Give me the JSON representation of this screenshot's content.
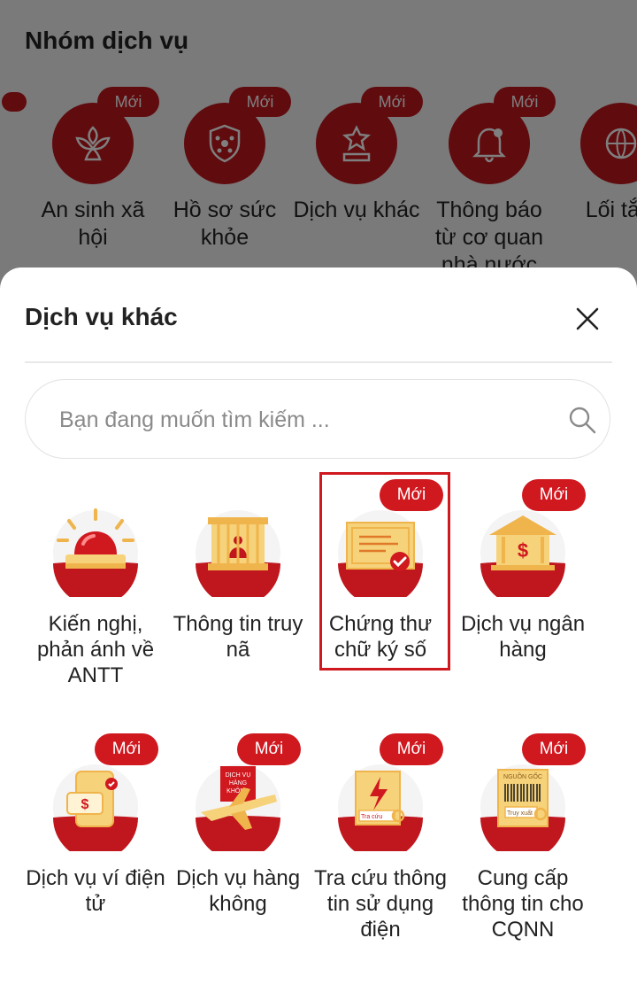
{
  "background": {
    "section_title": "Nhóm dịch vụ",
    "items": [
      {
        "label": "An sinh xã hội",
        "badge": "Mới",
        "icon": "flower-icon"
      },
      {
        "label": "Hồ sơ sức khỏe",
        "badge": "Mới",
        "icon": "health-shield-icon"
      },
      {
        "label": "Dịch vụ khác",
        "badge": "Mới",
        "icon": "star-podium-icon"
      },
      {
        "label": "Thông báo từ cơ quan nhà nước",
        "badge": "Mới",
        "icon": "bell-icon"
      },
      {
        "label": "Lối tắ c",
        "badge": "",
        "icon": "globe-icon"
      }
    ]
  },
  "sheet": {
    "title": "Dịch vụ khác",
    "search_placeholder": "Bạn đang muốn tìm kiếm ...",
    "items": [
      {
        "label": "Kiến nghị, phản ánh về ANTT",
        "badge": "",
        "icon": "siren-icon"
      },
      {
        "label": "Thông tin truy nã",
        "badge": "",
        "icon": "wanted-prison-icon"
      },
      {
        "label": "Chứng thư chữ ký số",
        "badge": "Mới",
        "icon": "certificate-icon",
        "selected": true
      },
      {
        "label": "Dịch vụ ngân hàng",
        "badge": "Mới",
        "icon": "bank-icon"
      },
      {
        "label": "Dịch vụ ví điện tử",
        "badge": "Mới",
        "icon": "e-wallet-icon"
      },
      {
        "label": "Dịch vụ hàng không",
        "badge": "Mới",
        "icon": "airplane-icon",
        "icon_text": [
          "DỊCH VỤ",
          "HÀNG",
          "KHÔNG"
        ]
      },
      {
        "label": "Tra cứu thông tin sử dụng điện",
        "badge": "Mới",
        "icon": "electricity-lookup-icon",
        "icon_text": [
          "Tra cứu"
        ]
      },
      {
        "label": "Cung cấp thông tin cho CQNN",
        "badge": "Mới",
        "icon": "barcode-origin-icon",
        "icon_text": [
          "NGUỒN GỐC",
          "Truy xuất"
        ]
      }
    ]
  },
  "colors": {
    "accent": "#d0181f",
    "icon_yellow": "#f6d27a",
    "icon_orange": "#f0b44c"
  }
}
